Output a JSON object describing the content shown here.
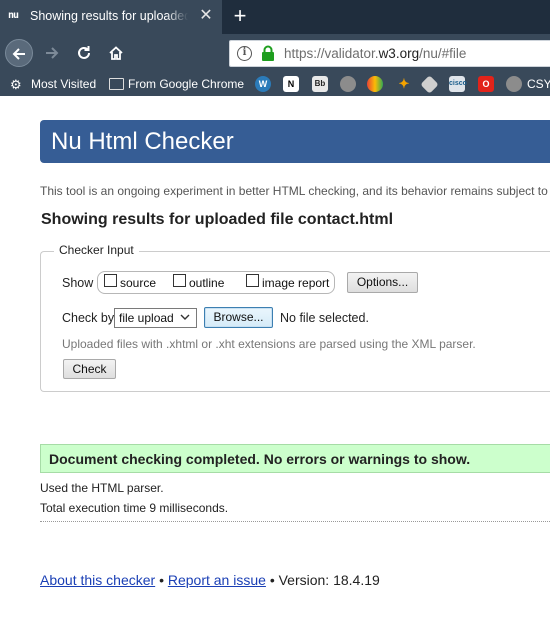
{
  "browser": {
    "tab_title": "Showing results for uploaded file contact.html",
    "favicon_text": "nu",
    "new_tab": "+",
    "url_prefix": "https://validator.",
    "url_host": "w3.org",
    "url_path": "/nu/#file",
    "bookmarks": {
      "most_visited": "Most Visited",
      "from_google_chrome": "From Google Chrome",
      "csy": "CSY"
    }
  },
  "page": {
    "title": "Nu Html Checker",
    "intro": "This tool is an ongoing experiment in better HTML checking, and its behavior remains subject to",
    "results_heading": "Showing results for uploaded file contact.html",
    "checker_input": {
      "legend": "Checker Input",
      "show_label": "Show",
      "options": [
        "source",
        "outline",
        "image report"
      ],
      "options_button": "Options...",
      "check_by_label": "Check by",
      "check_by_value": "file upload",
      "browse_button": "Browse...",
      "file_status": "No file selected.",
      "note": "Uploaded files with .xhtml or .xht extensions are parsed using the XML parser.",
      "check_button": "Check"
    },
    "success_message": "Document checking completed. No errors or warnings to show.",
    "parser_info": "Used the HTML parser.",
    "execution_time": "Total execution time 9 milliseconds.",
    "footer": {
      "about_link": "About this checker",
      "separator": "•",
      "report_link": "Report an issue",
      "version": "Version: 18.4.19"
    }
  },
  "colors": {
    "header_bg": "#365d95",
    "success_bg": "#ccffcc",
    "link": "#1a3fb5",
    "chrome_dark": "#39495a"
  }
}
